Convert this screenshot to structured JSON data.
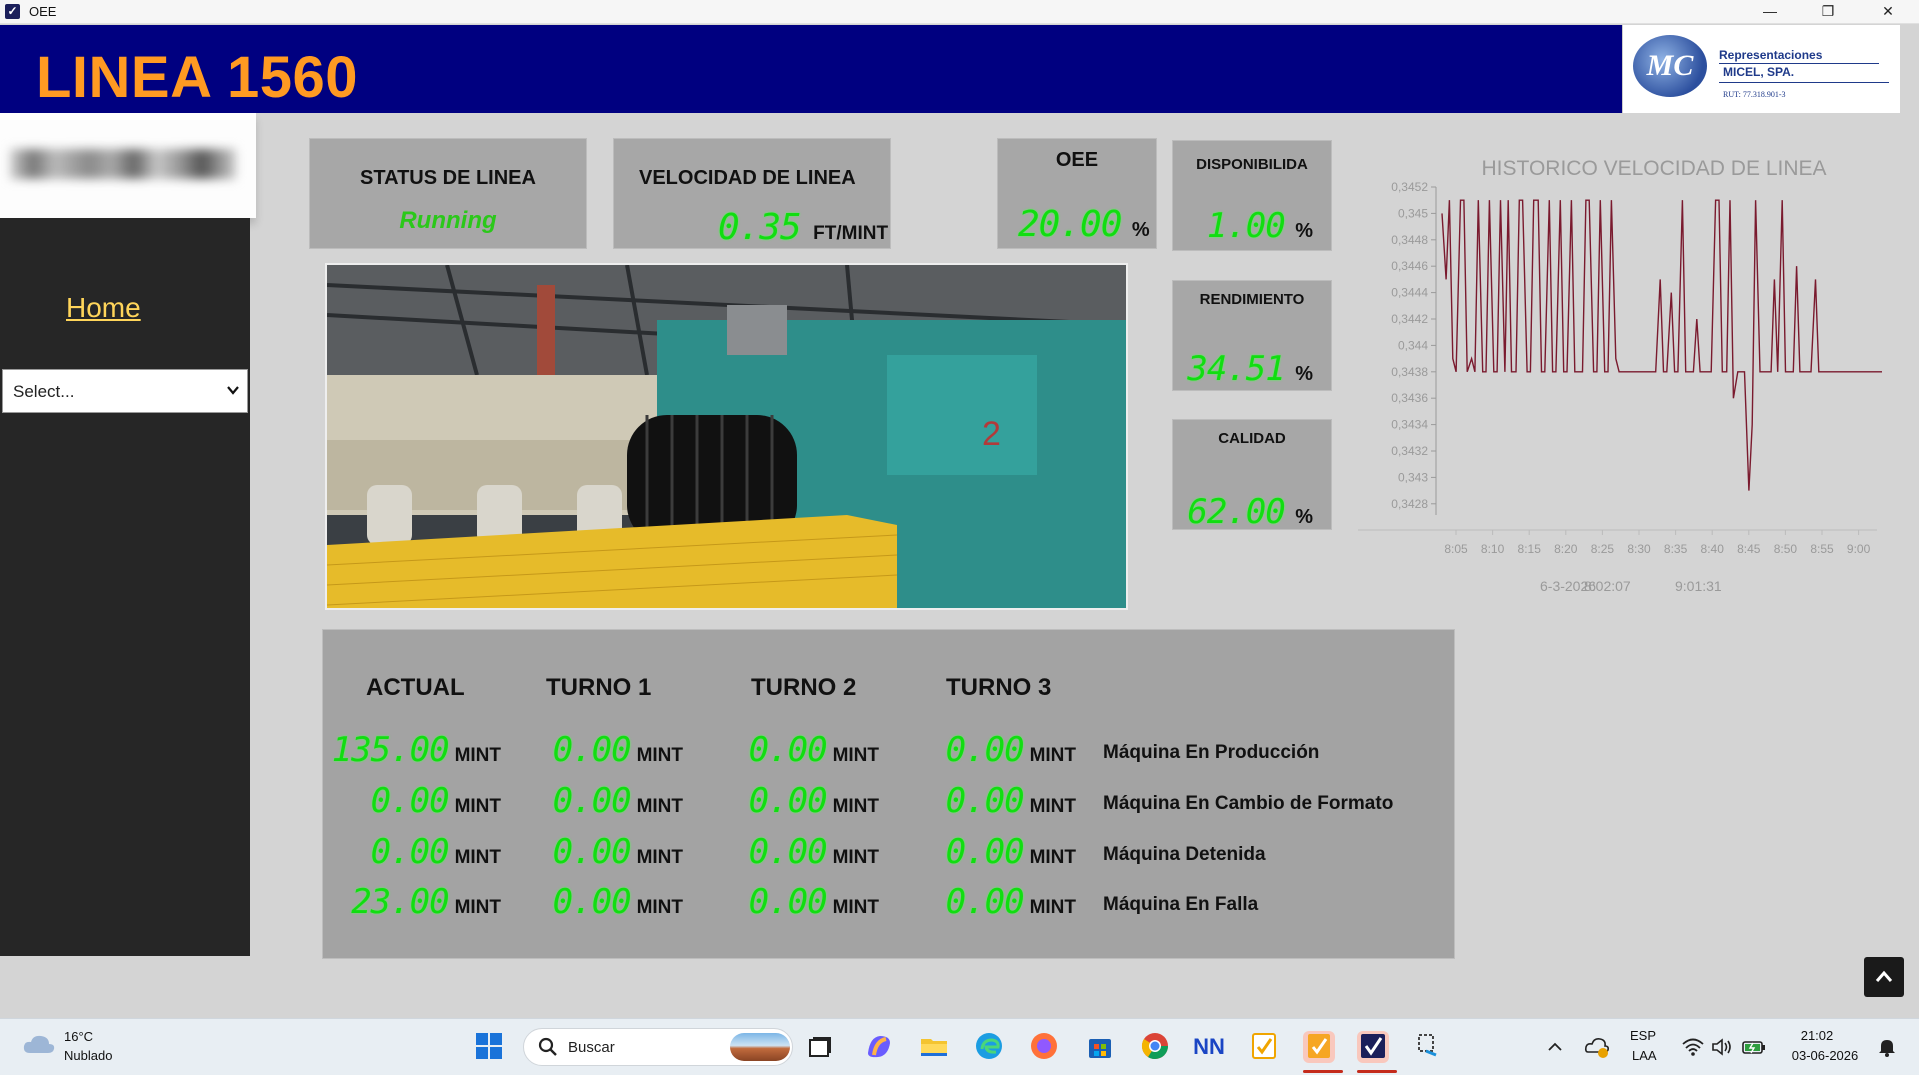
{
  "window": {
    "title": "OEE",
    "minimize": "—",
    "restore": "❐",
    "close": "✕"
  },
  "header": {
    "title": "LINEA 1560"
  },
  "logo": {
    "monogram": "MC",
    "line1": "Representaciones",
    "line2": "MICEL, SPA.",
    "line3": "RUT: 77.318.901-3"
  },
  "sidebar": {
    "home_label": "Home",
    "select_value": "Select...",
    "chevron": "⌄"
  },
  "status": {
    "label": "STATUS DE LINEA",
    "value": "Running"
  },
  "velocidad": {
    "label": "VELOCIDAD DE LINEA",
    "value": "0.35",
    "unit": "FT/MINT"
  },
  "oee": {
    "label": "OEE",
    "value": "20.00",
    "unit": "%"
  },
  "disponibilidad": {
    "label": "DISPONIBILIDA",
    "value": "1.00",
    "unit": "%"
  },
  "rendimiento": {
    "label": "RENDIMIENTO",
    "value": "34.51",
    "unit": "%"
  },
  "calidad": {
    "label": "CALIDAD",
    "value": "62.00",
    "unit": "%"
  },
  "chart_data": {
    "type": "line",
    "title": "HISTORICO VELOCIDAD DE LINEA",
    "xlabel": "",
    "ylabel": "",
    "y_ticks": [
      "0,3452",
      "0,345",
      "0,3448",
      "0,3446",
      "0,3444",
      "0,3442",
      "0,344",
      "0,3438",
      "0,3436",
      "0,3434",
      "0,3432",
      "0,343",
      "0,3428"
    ],
    "x_ticks": [
      "8:05",
      "8:10",
      "8:15",
      "8:20",
      "8:25",
      "8:30",
      "8:35",
      "8:40",
      "8:45",
      "8:50",
      "8:55",
      "9:00"
    ],
    "ylim": [
      0.3427,
      0.3452
    ],
    "grid": false,
    "line_color": "#7a1a2e",
    "footer": {
      "date": "6-3-2026",
      "start": "8:02:07",
      "end": "9:01:31"
    },
    "series": [
      {
        "x": [
          8.033,
          8.07,
          8.1,
          8.13,
          8.16,
          8.2,
          8.23,
          8.26,
          8.3,
          8.33,
          8.36,
          8.4,
          8.43,
          8.46,
          8.5,
          8.53,
          8.56,
          8.6,
          8.63,
          8.66,
          8.7,
          8.73,
          8.76,
          8.8,
          8.83,
          8.86,
          8.9,
          8.93,
          8.96,
          9.0,
          9.03,
          9.06,
          9.1,
          9.13,
          9.16,
          9.2,
          9.23,
          9.26,
          9.3,
          9.33,
          9.36,
          9.4,
          9.43,
          9.46,
          9.5,
          9.53,
          9.56,
          9.6,
          9.63,
          9.66,
          9.7,
          9.73,
          9.76,
          9.8,
          9.83,
          9.86,
          9.9,
          9.93,
          9.96,
          10.0,
          10.03,
          10.06,
          10.1,
          10.13,
          10.16,
          10.2,
          10.23,
          10.26,
          10.3,
          10.33,
          10.36,
          10.4,
          10.43,
          10.46,
          10.5,
          10.53,
          10.56,
          10.6,
          10.63,
          10.66,
          10.7,
          10.73,
          10.76,
          10.8,
          10.83,
          10.86,
          10.9,
          10.93,
          10.96,
          11.0,
          11.03,
          11.06,
          11.1,
          11.13,
          11.16,
          11.2,
          11.23,
          11.26,
          11.3,
          11.33,
          11.36,
          11.4,
          11.43,
          11.46,
          11.5,
          11.53,
          11.56,
          11.6,
          11.63,
          11.66,
          11.7,
          11.73,
          11.76,
          11.8,
          11.83,
          11.86,
          11.9,
          11.93,
          11.96,
          12.0
        ],
        "y": [
          0.345,
          0.3445,
          0.3451,
          0.3439,
          0.3438,
          0.3451,
          0.3451,
          0.3438,
          0.3439,
          0.3438,
          0.3451,
          0.3438,
          0.3438,
          0.3451,
          0.3438,
          0.3438,
          0.3451,
          0.3438,
          0.3451,
          0.3438,
          0.3438,
          0.3451,
          0.3451,
          0.3438,
          0.3438,
          0.3451,
          0.3451,
          0.3438,
          0.3438,
          0.3451,
          0.3438,
          0.3438,
          0.3451,
          0.3438,
          0.3438,
          0.3451,
          0.3438,
          0.3438,
          0.3438,
          0.3451,
          0.3451,
          0.3438,
          0.3438,
          0.3451,
          0.3438,
          0.3438,
          0.3451,
          0.3439,
          0.3438,
          0.3438,
          0.3438,
          0.3438,
          0.3438,
          0.3438,
          0.3438,
          0.3438,
          0.3438,
          0.3438,
          0.3438,
          0.3445,
          0.3438,
          0.3438,
          0.3444,
          0.3438,
          0.3438,
          0.3451,
          0.3438,
          0.3438,
          0.3438,
          0.3442,
          0.3438,
          0.3438,
          0.3438,
          0.3438,
          0.3451,
          0.3451,
          0.3438,
          0.3438,
          0.3451,
          0.3436,
          0.3438,
          0.3438,
          0.3438,
          0.3429,
          0.3434,
          0.3451,
          0.3438,
          0.3438,
          0.3438,
          0.3438,
          0.3445,
          0.3438,
          0.3451,
          0.3438,
          0.3438,
          0.3438,
          0.3446,
          0.3438,
          0.3438,
          0.3438,
          0.3438,
          0.3445,
          0.3438,
          0.3438,
          0.3438,
          0.3438,
          0.3438,
          0.3438,
          0.3438,
          0.3438,
          0.3438,
          0.3438,
          0.3438,
          0.3438,
          0.3438,
          0.3438,
          0.3438,
          0.3438,
          0.3438,
          0.3438
        ]
      }
    ]
  },
  "table": {
    "headers": [
      "ACTUAL",
      "TURNO 1",
      "TURNO 2",
      "TURNO 3"
    ],
    "unit": "MINT",
    "rows": [
      {
        "label": "Máquina En Producción",
        "values": [
          "135.00",
          "0.00",
          "0.00",
          "0.00"
        ]
      },
      {
        "label": "Máquina En Cambio de Formato",
        "values": [
          "0.00",
          "0.00",
          "0.00",
          "0.00"
        ]
      },
      {
        "label": "Máquina Detenida",
        "values": [
          "0.00",
          "0.00",
          "0.00",
          "0.00"
        ]
      },
      {
        "label": "Máquina En Falla",
        "values": [
          "23.00",
          "0.00",
          "0.00",
          "0.00"
        ]
      }
    ]
  },
  "scroll_top": "⌃",
  "taskbar": {
    "temp": "16°C",
    "condition": "Nublado",
    "search_placeholder": "Buscar",
    "lang1": "ESP",
    "lang2": "LAA",
    "time": "21:02",
    "date": "03-06-2026"
  }
}
